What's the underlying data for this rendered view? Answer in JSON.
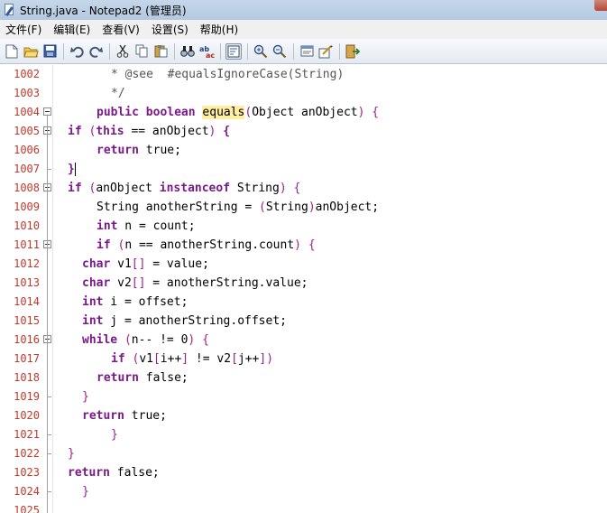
{
  "window": {
    "title": "String.java - Notepad2 (管理员)"
  },
  "menu": [
    "文件(F)",
    "编辑(E)",
    "查看(V)",
    "设置(S)",
    "帮助(H)"
  ],
  "toolbar": [
    {
      "name": "new-file-icon"
    },
    {
      "name": "open-folder-icon"
    },
    {
      "name": "save-icon"
    },
    "sep",
    {
      "name": "undo-icon"
    },
    {
      "name": "redo-icon"
    },
    "sep",
    {
      "name": "cut-icon"
    },
    {
      "name": "copy-icon"
    },
    {
      "name": "paste-icon"
    },
    "sep",
    {
      "name": "find-icon"
    },
    {
      "name": "replace-icon"
    },
    "sep",
    {
      "name": "word-wrap-icon",
      "pressed": true
    },
    "sep",
    {
      "name": "zoom-in-icon"
    },
    {
      "name": "zoom-out-icon"
    },
    "sep",
    {
      "name": "scheme-icon"
    },
    {
      "name": "customize-icon"
    },
    "sep",
    {
      "name": "exit-icon"
    }
  ],
  "editor": {
    "lines": [
      {
        "num": "1002",
        "indent": 4,
        "fold": null,
        "tokens": [
          [
            "cm",
            "* @see  #equalsIgnoreCase(String)"
          ]
        ]
      },
      {
        "num": "1003",
        "indent": 4,
        "fold": null,
        "tokens": [
          [
            "cm",
            "*/"
          ]
        ]
      },
      {
        "num": "1004",
        "indent": 3,
        "fold": "box",
        "tokens": [
          [
            "kw",
            "public"
          ],
          [
            "",
            " "
          ],
          [
            "kw",
            "boolean"
          ],
          [
            "",
            " "
          ],
          [
            "hl",
            "equals"
          ],
          [
            "pu",
            "("
          ],
          [
            "",
            "Object anObject"
          ],
          [
            "pu",
            ")"
          ],
          [
            "",
            " "
          ],
          [
            "pu",
            "{"
          ]
        ]
      },
      {
        "num": "1005",
        "indent": 1,
        "fold": "box",
        "tokens": [
          [
            "kw",
            "if"
          ],
          [
            "",
            " "
          ],
          [
            "pu",
            "("
          ],
          [
            "kw",
            "this"
          ],
          [
            "",
            " == anObject"
          ],
          [
            "pu",
            ")"
          ],
          [
            "",
            " "
          ],
          [
            "kw",
            "{"
          ]
        ]
      },
      {
        "num": "1006",
        "indent": 3,
        "fold": null,
        "tokens": [
          [
            "kw",
            "return"
          ],
          [
            "",
            " true;"
          ]
        ]
      },
      {
        "num": "1007",
        "indent": 1,
        "fold": "end",
        "tokens": [
          [
            "kw",
            "}"
          ],
          [
            "caret",
            ""
          ]
        ]
      },
      {
        "num": "1008",
        "indent": 1,
        "fold": "box",
        "tokens": [
          [
            "kw",
            "if"
          ],
          [
            "",
            " "
          ],
          [
            "pu",
            "("
          ],
          [
            "",
            "anObject "
          ],
          [
            "kw",
            "instanceof"
          ],
          [
            "",
            " String"
          ],
          [
            "pu",
            ")"
          ],
          [
            "",
            " "
          ],
          [
            "pu",
            "{"
          ]
        ]
      },
      {
        "num": "1009",
        "indent": 3,
        "fold": null,
        "tokens": [
          [
            "",
            "String anotherString = "
          ],
          [
            "pu",
            "("
          ],
          [
            "",
            "String"
          ],
          [
            "pu",
            ")"
          ],
          [
            "",
            "anObject;"
          ]
        ]
      },
      {
        "num": "1010",
        "indent": 3,
        "fold": null,
        "tokens": [
          [
            "kw",
            "int"
          ],
          [
            "",
            " n = count;"
          ]
        ]
      },
      {
        "num": "1011",
        "indent": 3,
        "fold": "box",
        "tokens": [
          [
            "kw",
            "if"
          ],
          [
            "",
            " "
          ],
          [
            "pu",
            "("
          ],
          [
            "",
            "n == anotherString.count"
          ],
          [
            "pu",
            ")"
          ],
          [
            "",
            " "
          ],
          [
            "pu",
            "{"
          ]
        ]
      },
      {
        "num": "1012",
        "indent": 2,
        "fold": null,
        "tokens": [
          [
            "kw",
            "char"
          ],
          [
            "",
            " v1"
          ],
          [
            "pu",
            "[]"
          ],
          [
            "",
            " = value;"
          ]
        ]
      },
      {
        "num": "1013",
        "indent": 2,
        "fold": null,
        "tokens": [
          [
            "kw",
            "char"
          ],
          [
            "",
            " v2"
          ],
          [
            "pu",
            "[]"
          ],
          [
            "",
            " = anotherString.value;"
          ]
        ]
      },
      {
        "num": "1014",
        "indent": 2,
        "fold": null,
        "tokens": [
          [
            "kw",
            "int"
          ],
          [
            "",
            " i = offset;"
          ]
        ]
      },
      {
        "num": "1015",
        "indent": 2,
        "fold": null,
        "tokens": [
          [
            "kw",
            "int"
          ],
          [
            "",
            " j = anotherString.offset;"
          ]
        ]
      },
      {
        "num": "1016",
        "indent": 2,
        "fold": "box",
        "tokens": [
          [
            "kw",
            "while"
          ],
          [
            "",
            " "
          ],
          [
            "pu",
            "("
          ],
          [
            "",
            "n-- != 0"
          ],
          [
            "pu",
            ")"
          ],
          [
            "",
            " "
          ],
          [
            "pu",
            "{"
          ]
        ]
      },
      {
        "num": "1017",
        "indent": 4,
        "fold": null,
        "tokens": [
          [
            "kw",
            "if"
          ],
          [
            "",
            " "
          ],
          [
            "pu",
            "("
          ],
          [
            "",
            "v1"
          ],
          [
            "pu",
            "["
          ],
          [
            "",
            "i++"
          ],
          [
            "pu",
            "]"
          ],
          [
            "",
            " != v2"
          ],
          [
            "pu",
            "["
          ],
          [
            "",
            "j++"
          ],
          [
            "pu",
            "])"
          ]
        ]
      },
      {
        "num": "1018",
        "indent": 3,
        "fold": null,
        "tokens": [
          [
            "kw",
            "return"
          ],
          [
            "",
            " false;"
          ]
        ]
      },
      {
        "num": "1019",
        "indent": 2,
        "fold": "end",
        "tokens": [
          [
            "pu",
            "}"
          ]
        ]
      },
      {
        "num": "1020",
        "indent": 2,
        "fold": null,
        "tokens": [
          [
            "kw",
            "return"
          ],
          [
            "",
            " true;"
          ]
        ]
      },
      {
        "num": "1021",
        "indent": 4,
        "fold": "end",
        "tokens": [
          [
            "pu",
            "}"
          ]
        ]
      },
      {
        "num": "1022",
        "indent": 1,
        "fold": "end",
        "tokens": [
          [
            "pu",
            "}"
          ]
        ]
      },
      {
        "num": "1023",
        "indent": 1,
        "fold": null,
        "tokens": [
          [
            "kw",
            "return"
          ],
          [
            "",
            " false;"
          ]
        ]
      },
      {
        "num": "1024",
        "indent": 2,
        "fold": "end",
        "tokens": [
          [
            "pu",
            "}"
          ]
        ]
      },
      {
        "num": "1025",
        "indent": 0,
        "fold": null,
        "tokens": []
      }
    ]
  }
}
